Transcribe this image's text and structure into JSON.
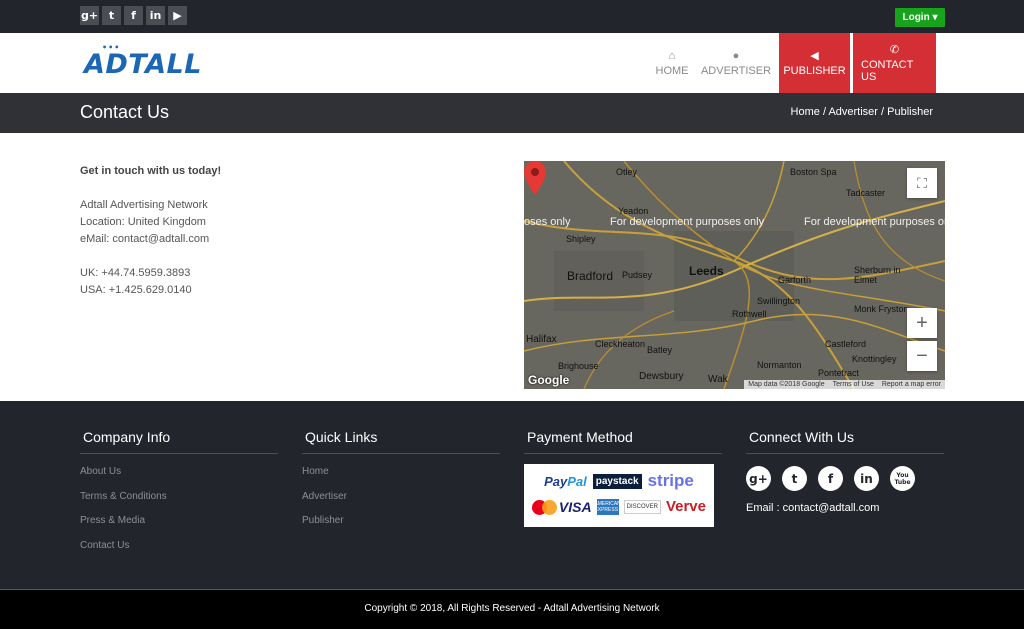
{
  "topbar": {
    "social": [
      {
        "icon": "google-plus-icon",
        "glyph": "g+"
      },
      {
        "icon": "twitter-icon",
        "glyph": "t"
      },
      {
        "icon": "facebook-icon",
        "glyph": "f"
      },
      {
        "icon": "linkedin-icon",
        "glyph": "in"
      },
      {
        "icon": "youtube-icon",
        "glyph": "▶"
      }
    ],
    "login_label": "Login ▾"
  },
  "header": {
    "logo": "ADTALL",
    "nav": [
      {
        "label": "HOME",
        "icon": "home-icon"
      },
      {
        "label": "ADVERTISER",
        "icon": "user-icon"
      },
      {
        "label": "PUBLISHER",
        "icon": "megaphone-icon"
      },
      {
        "label": "CONTACT US",
        "icon": "phone-icon"
      }
    ]
  },
  "titlebar": {
    "title": "Contact Us",
    "breadcrumb": "Home / Advertiser / Publisher"
  },
  "contact": {
    "lead": "Get in touch with us today!",
    "company": "Adtall Advertising Network",
    "location": "Location: United Kingdom",
    "email": "eMail: contact@adtall.com",
    "uk": "UK: +44.74.5959.3893",
    "usa": "USA: +1.425.629.0140"
  },
  "map": {
    "dev_text": "For development purposes only",
    "dev_left": "oses only",
    "cities": [
      "Otley",
      "Boston Spa",
      "Tadcaster",
      "Yeadon",
      "Shipley",
      "Bradford",
      "Pudsey",
      "Leeds",
      "Garforth",
      "Sherburn in Elmet",
      "Swillington",
      "Rothwell",
      "Monk Fryston",
      "Halifax",
      "Cleckheaton",
      "Batley",
      "Castleford",
      "Knottingley",
      "Brighouse",
      "Dewsbury",
      "Normanton",
      "Pontefract",
      "Wak"
    ],
    "footer": [
      "Map data ©2018 Google",
      "Terms of Use",
      "Report a map error"
    ],
    "google": "Google",
    "zoom_in": "+",
    "zoom_out": "−",
    "fullscreen": "⛶"
  },
  "footer": {
    "company_title": "Company Info",
    "company_links": [
      "About Us",
      "Terms & Conditions",
      "Press & Media",
      "Contact Us"
    ],
    "quick_title": "Quick Links",
    "quick_links": [
      "Home",
      "Advertiser",
      "Publisher"
    ],
    "payment_title": "Payment Method",
    "payment": {
      "paypal_a": "Pay",
      "paypal_b": "Pal",
      "paystack": "paystack",
      "stripe": "stripe",
      "mastercard": "MasterCard",
      "visa": "VISA",
      "amex": "AMERICAN EXPRESS",
      "discover": "DISCOVER",
      "verve": "Verve"
    },
    "connect_title": "Connect With Us",
    "social": [
      {
        "icon": "google-plus-icon",
        "glyph": "g+"
      },
      {
        "icon": "twitter-icon",
        "glyph": "t"
      },
      {
        "icon": "facebook-icon",
        "glyph": "f"
      },
      {
        "icon": "linkedin-icon",
        "glyph": "in"
      },
      {
        "icon": "youtube-icon",
        "glyph": "You Tube"
      }
    ],
    "email": "Email : contact@adtall.com"
  },
  "copyright": "Copyright © 2018, All Rights Reserved - Adtall Advertising Network",
  "colors": {
    "accent": "#d32f35",
    "login": "#17a31c",
    "dark": "#22252b",
    "logo": "#1b66b5"
  }
}
